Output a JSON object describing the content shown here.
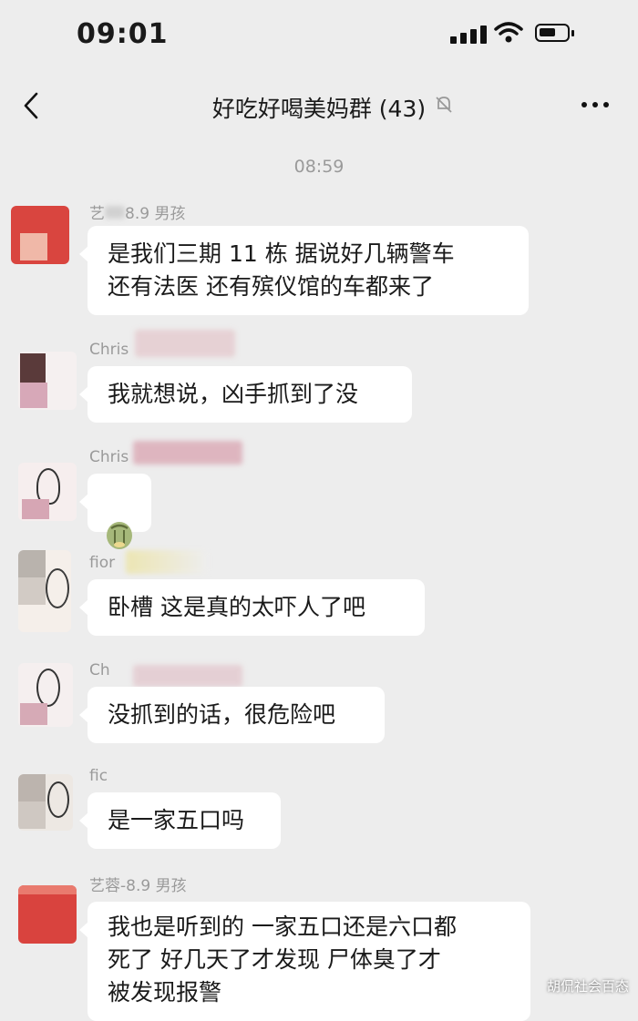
{
  "status_bar": {
    "time": "09:01"
  },
  "nav": {
    "title": "好吃好喝美妈群 (43)"
  },
  "timestamp": "08:59",
  "messages": [
    {
      "sender": "艺",
      "sender_tail": "8.9 男孩",
      "text": "是我们三期 11 栋   据说好几辆警车\n还有法医  还有殡仪馆的车都来了"
    },
    {
      "sender": "Chris",
      "sender_tail": "",
      "text": "我就想说，凶手抓到了没"
    },
    {
      "sender": "Chris",
      "sender_tail": "",
      "sticker": "melon-sticker"
    },
    {
      "sender": "fior",
      "sender_tail": "",
      "text": "卧槽  这是真的太吓人了吧"
    },
    {
      "sender": "Ch",
      "sender_tail": "",
      "text": "没抓到的话，很危险吧"
    },
    {
      "sender": "fic",
      "sender_tail": "",
      "text": "是一家五口吗"
    },
    {
      "sender": "艺蓉-8.9 男孩",
      "sender_tail": "",
      "text": "我也是听到的   一家五口还是六口都\n死了   好几天了才发现  尸体臭了才\n被发现报警"
    }
  ],
  "watermark": "胡侃社会百态",
  "colors": {
    "background": "#ededed",
    "bubble": "#ffffff",
    "meta_text": "#9a9a9a"
  }
}
